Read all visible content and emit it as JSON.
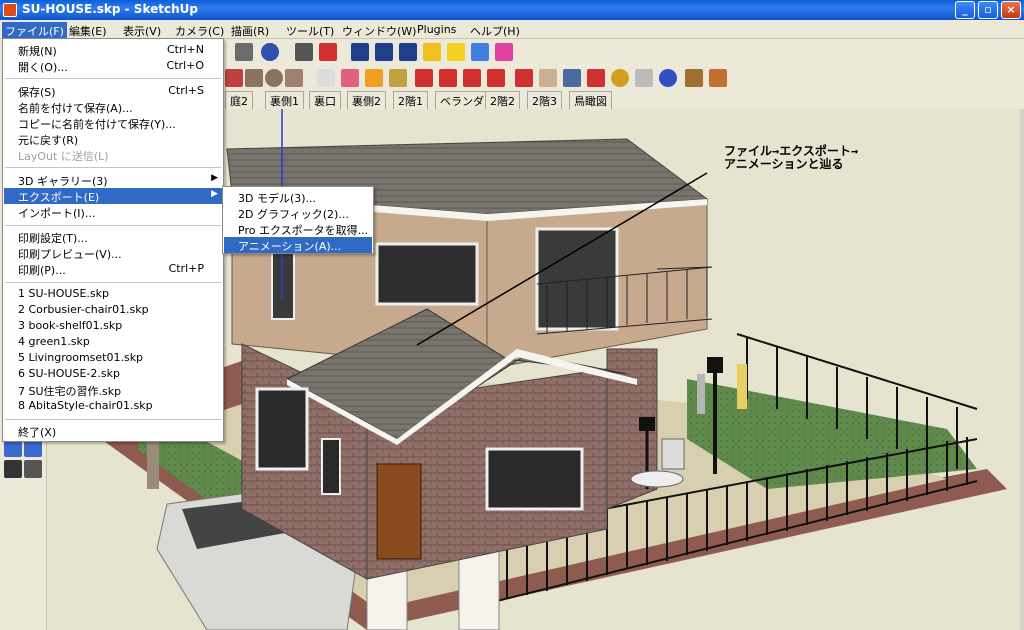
{
  "window": {
    "title": "SU-HOUSE.skp - SketchUp",
    "minimize": "_",
    "maximize": "▫",
    "close": "×"
  },
  "menubar": {
    "items": [
      "ファイル(F)",
      "編集(E)",
      "表示(V)",
      "カメラ(C)",
      "描画(R)",
      "ツール(T)",
      "ウィンドウ(W)",
      "Plugins",
      "ヘルプ(H)"
    ]
  },
  "scene_tabs": [
    "庭2",
    "裏側1",
    "裏口",
    "裏側2",
    "2階1",
    "ベランダ",
    "2階2",
    "2階3",
    "鳥瞰図"
  ],
  "file_menu": {
    "items": [
      {
        "label": "新規(N)",
        "shortcut": "Ctrl+N"
      },
      {
        "label": "開く(O)...",
        "shortcut": "Ctrl+O"
      },
      {
        "label": "保存(S)",
        "shortcut": "Ctrl+S"
      },
      {
        "label": "名前を付けて保存(A)...",
        "shortcut": ""
      },
      {
        "label": "コピーに名前を付けて保存(Y)...",
        "shortcut": ""
      },
      {
        "label": "元に戻す(R)",
        "shortcut": ""
      },
      {
        "label": "LayOut に送信(L)",
        "shortcut": ""
      },
      {
        "label": "3D ギャラリー(3)",
        "shortcut": ""
      },
      {
        "label": "エクスポート(E)",
        "shortcut": ""
      },
      {
        "label": "インポート(I)...",
        "shortcut": ""
      },
      {
        "label": "印刷設定(T)...",
        "shortcut": ""
      },
      {
        "label": "印刷プレビュー(V)...",
        "shortcut": ""
      },
      {
        "label": "印刷(P)...",
        "shortcut": "Ctrl+P"
      },
      {
        "label": "1 SU-HOUSE.skp",
        "shortcut": ""
      },
      {
        "label": "2 Corbusier-chair01.skp",
        "shortcut": ""
      },
      {
        "label": "3 book-shelf01.skp",
        "shortcut": ""
      },
      {
        "label": "4 green1.skp",
        "shortcut": ""
      },
      {
        "label": "5 Livingroomset01.skp",
        "shortcut": ""
      },
      {
        "label": "6 SU-HOUSE-2.skp",
        "shortcut": ""
      },
      {
        "label": "7 SU住宅の習作.skp",
        "shortcut": ""
      },
      {
        "label": "8 AbitaStyle-chair01.skp",
        "shortcut": ""
      },
      {
        "label": "終了(X)",
        "shortcut": ""
      }
    ],
    "submenu_arrow": "▶"
  },
  "export_submenu": {
    "items": [
      "3D モデル(3)...",
      "2D グラフィック(2)...",
      "Pro エクスポータを取得...",
      "アニメーション(A)..."
    ]
  },
  "annotation": {
    "line1": "ファイル→エクスポート→",
    "line2": "アニメーションと辿る"
  },
  "colors": {
    "titlebar": "#0a5fd8",
    "menu_highlight": "#316ac5",
    "chrome": "#ece9d8",
    "wall": "#c7a98d",
    "brick": "#8f6f68",
    "roof": "#7a746e",
    "lawn": "#5f8a4c",
    "door": "#8a4a20"
  }
}
